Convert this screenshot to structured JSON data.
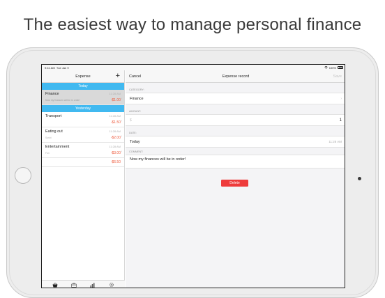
{
  "headline": "The easiest way to manage personal finance",
  "status": {
    "time": "9:41 AM",
    "date": "Tue Jan 9",
    "battery": "100%"
  },
  "left": {
    "title": "Expense",
    "add_label": "+",
    "sections": [
      {
        "header": "Today",
        "entries": [
          {
            "name": "Finance",
            "time": "11:28 AM",
            "comment": "Now my finances will be in order!",
            "amount": "-$1.00",
            "selected": true
          }
        ]
      },
      {
        "header": "Yesterday",
        "entries": [
          {
            "name": "Transport",
            "time": "11:28 AM",
            "comment": "",
            "amount": "-$1.50"
          },
          {
            "name": "Eating out",
            "time": "11:28 AM",
            "comment": "Sushi",
            "amount": "-$2.00"
          },
          {
            "name": "Entertainment",
            "time": "11:28 AM",
            "comment": "Fun",
            "amount": "-$3.00"
          }
        ],
        "subtotal": "-$6.50"
      }
    ],
    "tabs": [
      {
        "icon": "basket-icon",
        "label": "Expense"
      },
      {
        "icon": "briefcase-icon",
        "label": "Accounts"
      },
      {
        "icon": "bar-chart-icon",
        "label": "Reports"
      },
      {
        "icon": "gear-icon",
        "label": "Settings"
      }
    ]
  },
  "right": {
    "cancel_label": "Cancel",
    "title": "Expense record",
    "save_label": "Save",
    "category_label": "CATEGORY:",
    "category_value": "Finance",
    "amount_label": "AMOUNT:",
    "amount_currency": "$",
    "amount_value": "1",
    "date_label": "DATE:",
    "date_value": "Today",
    "date_time": "11:28 AM",
    "comment_label": "COMMENT:",
    "comment_value": "Now my finances will be in order!",
    "delete_label": "Delete"
  },
  "colors": {
    "accent": "#41b9f0",
    "expense": "#ee5a3c",
    "delete": "#ee3b3b"
  }
}
